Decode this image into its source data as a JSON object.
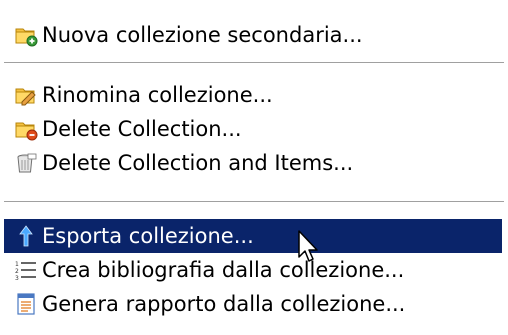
{
  "menu": {
    "items": [
      {
        "label": "Nuova collezione secondaria...",
        "icon": "new-subcollection-icon"
      },
      {
        "label": "Rinomina collezione...",
        "icon": "rename-folder-icon"
      },
      {
        "label": "Delete Collection...",
        "icon": "delete-folder-icon"
      },
      {
        "label": "Delete Collection and Items...",
        "icon": "trash-can-icon"
      },
      {
        "label": "Esporta collezione...",
        "icon": "export-arrow-icon",
        "highlighted": true
      },
      {
        "label": "Crea bibliografia dalla collezione...",
        "icon": "bibliography-list-icon"
      },
      {
        "label": "Genera rapporto dalla collezione...",
        "icon": "report-document-icon"
      }
    ]
  },
  "colors": {
    "highlight": "#0a246a",
    "folder": "#f5c242",
    "separator": "#a0a0a0"
  }
}
